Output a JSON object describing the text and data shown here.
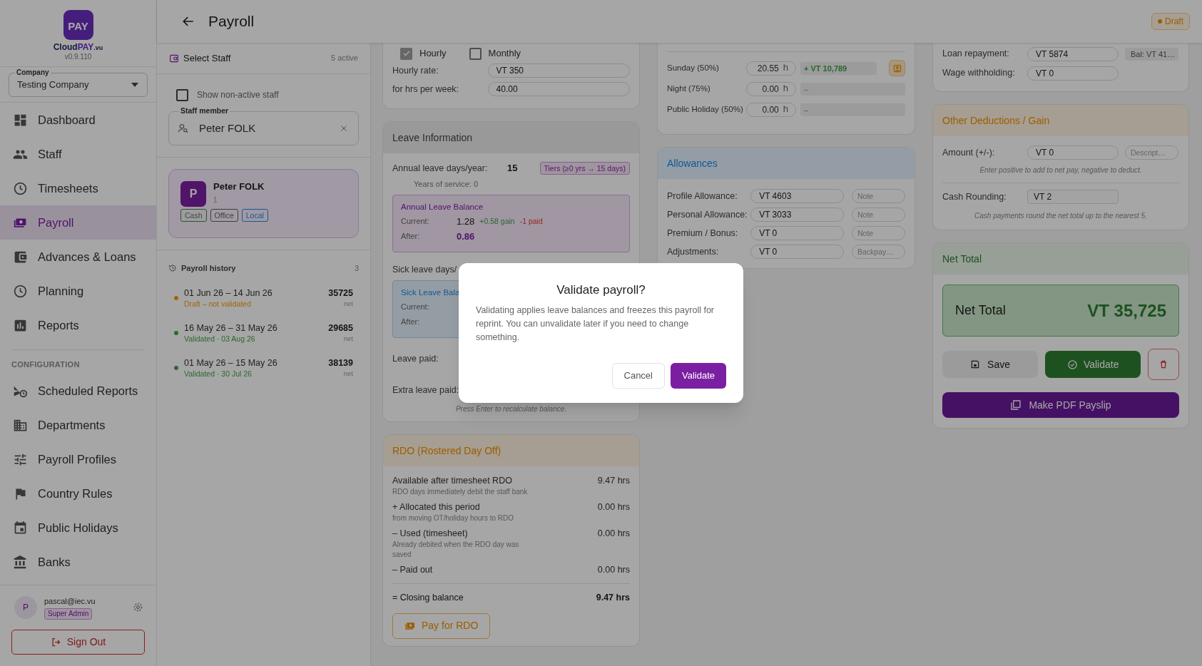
{
  "sidebar": {
    "logo_text": "PAY",
    "brand": {
      "prefix": "Cloud",
      "highlight": "PAY",
      "suffix": ".vu"
    },
    "version": "v0.9.110",
    "company": {
      "label": "Company",
      "value": "Testing Company"
    },
    "nav": [
      {
        "label": "Dashboard",
        "selected": false
      },
      {
        "label": "Staff",
        "selected": false
      },
      {
        "label": "Timesheets",
        "selected": false
      },
      {
        "label": "Payroll",
        "selected": true
      },
      {
        "label": "Advances & Loans",
        "selected": false
      },
      {
        "label": "Planning",
        "selected": false
      },
      {
        "label": "Reports",
        "selected": false
      }
    ],
    "section_label": "CONFIGURATION",
    "config_nav": [
      {
        "label": "Scheduled Reports",
        "selected": false
      },
      {
        "label": "Departments",
        "selected": false
      },
      {
        "label": "Payroll Profiles",
        "selected": false
      },
      {
        "label": "Country Rules",
        "selected": false
      },
      {
        "label": "Public Holidays",
        "selected": false
      },
      {
        "label": "Banks",
        "selected": false
      }
    ],
    "user": {
      "initial": "P",
      "email": "pascal@iec.vu",
      "role": "Super Admin"
    },
    "sign_out": "Sign Out"
  },
  "header": {
    "title": "Payroll",
    "status": "Draft"
  },
  "staff_panel": {
    "title": "Select Staff",
    "count": "5 active",
    "show_inactive": {
      "label": "Show non-active staff",
      "checked": false
    },
    "staff_field": {
      "label": "Staff member",
      "value": "Peter FOLK"
    },
    "staff_card": {
      "initial": "P",
      "name": "Peter FOLK",
      "number": "1",
      "tags": [
        {
          "label": "Cash",
          "color": "#245c27"
        },
        {
          "label": "Office",
          "color": "#3f3f3f"
        },
        {
          "label": "Local",
          "color": "#145895"
        }
      ]
    },
    "history": {
      "title": "Payroll history",
      "count": "3",
      "items": [
        {
          "period": "01 Jun 26 – 14 Jun 26",
          "status": "Draft – not validated",
          "color": "#9f6707",
          "amount": "35725",
          "unit": "net"
        },
        {
          "period": "16 May 26 – 31 May 26",
          "status": "Validated · 03 Aug 26",
          "color": "#2c682e",
          "amount": "29685",
          "unit": "net"
        },
        {
          "period": "01 May 26 – 15 May 26",
          "status": "Validated · 30 Jul 26",
          "color": "#2c682e",
          "amount": "38139",
          "unit": "net"
        }
      ]
    }
  },
  "pay_basis": {
    "options": [
      {
        "label": "Hourly",
        "checked": true
      },
      {
        "label": "Monthly",
        "checked": false
      }
    ],
    "fields": [
      {
        "label": "Hourly rate:",
        "value": "VT 350"
      },
      {
        "label": "for hrs per week:",
        "value": "40.00"
      }
    ]
  },
  "leave": {
    "title": "Leave Information",
    "annual_label": "Annual leave days/year:",
    "annual_value": "15",
    "tiers": "Tiers (≥0 yrs → 15 days)",
    "service": "Years of service: 0",
    "annual_balance": {
      "title": "Annual Leave Balance",
      "current_label": "Current:",
      "current": "1.28",
      "gain": "+0.58 gain",
      "paid": "-1 paid",
      "after_label": "After:",
      "after": "0.86"
    },
    "sick_label": "Sick leave days/",
    "sick_balance": {
      "title": "Sick Leave Bala",
      "current_label": "Current:",
      "after_label": "After:"
    },
    "leave_paid_label": "Leave paid:",
    "extra_leave_label": "Extra leave paid:",
    "hint": "Press Enter to recalculate balance."
  },
  "rdo": {
    "title": "RDO (Rostered Day Off)",
    "rows": [
      {
        "label": "Available after timesheet RDO",
        "note": "RDO days immediately debit the staff bank",
        "value": "9.47 hrs"
      },
      {
        "label": "+ Allocated this period",
        "note": "from moving OT/holiday hours to RDO",
        "value": "0.00 hrs"
      },
      {
        "label": "– Used (timesheet)",
        "note": "Already debited when the RDO day was saved",
        "value": "0.00 hrs"
      },
      {
        "label": "– Paid out",
        "value": "0.00 hrs"
      }
    ],
    "closing": {
      "label": "= Closing balance",
      "value": "9.47 hrs"
    },
    "button": "Pay for RDO"
  },
  "overtime": {
    "rows": [
      {
        "label": "Sunday (50%)",
        "hours": "20.55",
        "unit": "h",
        "amount": "+ VT 10,789",
        "active": true
      },
      {
        "label": "Night (75%)",
        "hours": "0.00",
        "unit": "h",
        "amount": "–",
        "active": false
      },
      {
        "label": "Public Holiday (50%)",
        "hours": "0.00",
        "unit": "h",
        "amount": "–",
        "active": false
      }
    ]
  },
  "allowances": {
    "title": "Allowances",
    "rows": [
      {
        "label": "Profile Allowance:",
        "value": "VT 4603",
        "placeholder": "Note"
      },
      {
        "label": "Personal Allowance:",
        "value": "VT 3033",
        "placeholder": "Note"
      },
      {
        "label": "Premium / Bonus:",
        "value": "VT 0",
        "placeholder": "Note"
      },
      {
        "label": "Adjustments:",
        "value": "VT 0",
        "placeholder": "Backpay…"
      }
    ]
  },
  "deductions": {
    "rows": [
      {
        "label": "Loan repayment:",
        "value": "VT 5874",
        "balance": "Bal: VT 41…"
      },
      {
        "label": "Wage withholding:",
        "value": "VT 0"
      }
    ]
  },
  "other": {
    "title": "Other Deductions / Gain",
    "amount_label": "Amount (+/-):",
    "amount": "VT 0",
    "placeholder": "Descript…",
    "hint": "Enter positive to add to net pay, negative to deduct.",
    "rounding_label": "Cash Rounding:",
    "rounding": "VT 2",
    "rounding_hint": "Cash payments round the net total up to the nearest 5."
  },
  "net": {
    "title": "Net Total",
    "label": "Net Total",
    "value": "VT 35,725",
    "save": "Save",
    "validate": "Validate",
    "pdf": "Make PDF Payslip"
  },
  "dialog": {
    "title": "Validate payroll?",
    "message": "Validating applies leave balances and freezes this payroll for reprint. You can unvalidate later if you need to change something.",
    "cancel": "Cancel",
    "confirm": "Validate"
  }
}
